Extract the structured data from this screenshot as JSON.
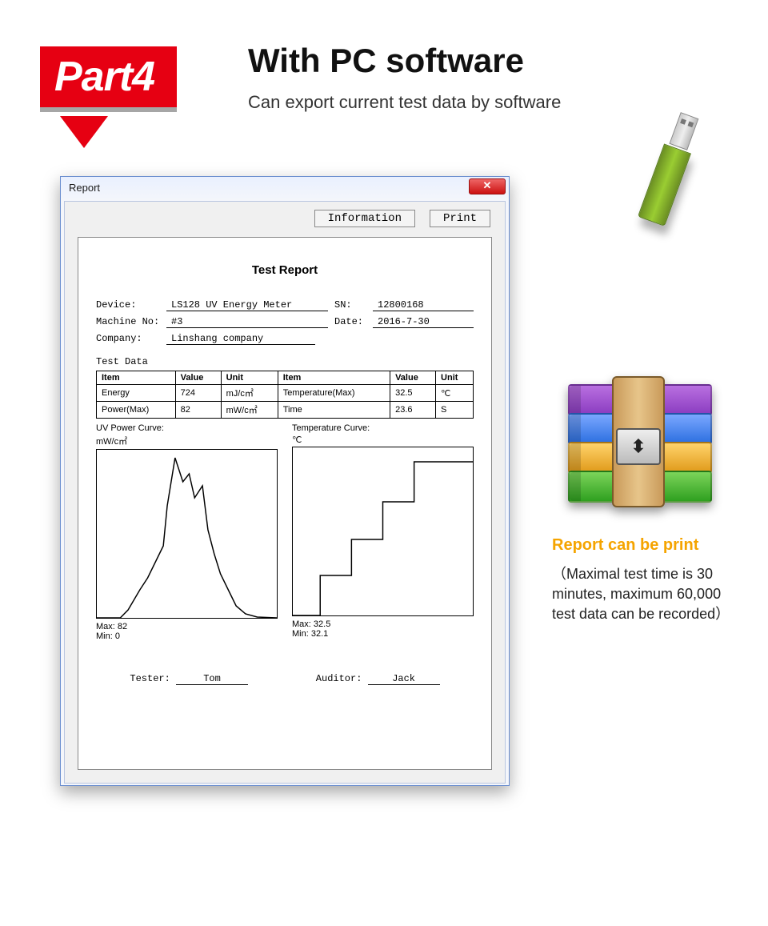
{
  "badge": "Part4",
  "headline": "With PC software",
  "subhead": "Can export current test data by software",
  "window": {
    "title": "Report",
    "toolbar": {
      "info": "Information",
      "print": "Print"
    },
    "report_title": "Test Report",
    "meta": {
      "device_label": "Device:",
      "device": "LS128 UV Energy Meter",
      "sn_label": "SN:",
      "sn": "12800168",
      "machine_label": "Machine No:",
      "machine": "#3",
      "date_label": "Date:",
      "date": "2016-7-30",
      "company_label": "Company:",
      "company": "Linshang company"
    },
    "section_test_data": "Test Data",
    "table": {
      "headers": [
        "Item",
        "Value",
        "Unit",
        "Item",
        "Value",
        "Unit"
      ],
      "rows": [
        [
          "Energy",
          "724",
          "mJ/c㎡",
          "Temperature(Max)",
          "32.5",
          "℃"
        ],
        [
          "Power(Max)",
          "82",
          "mW/c㎡",
          "Time",
          "23.6",
          "S"
        ]
      ]
    },
    "chart_left": {
      "title": "UV Power Curve:",
      "unit": "mW/c㎡",
      "max_label": "Max:",
      "max": "82",
      "min_label": "Min:",
      "min": "0"
    },
    "chart_right": {
      "title": "Temperature Curve:",
      "unit": "℃",
      "max_label": "Max:",
      "max": "32.5",
      "min_label": "Min:",
      "min": "32.1"
    },
    "tester_label": "Tester:",
    "tester": "Tom",
    "auditor_label": "Auditor:",
    "auditor": "Jack"
  },
  "print_head": "Report can be print",
  "print_body": "（Maximal test time is 30 minutes, maximum 60,000 test data can be recorded）",
  "chart_data": [
    {
      "type": "line",
      "title": "UV Power Curve",
      "ylabel": "mW/c㎡",
      "ylim": [
        0,
        82
      ],
      "x": [
        0,
        1,
        2,
        3,
        4,
        5,
        6,
        7,
        8,
        9,
        10,
        11,
        12,
        13,
        14,
        15,
        16,
        17,
        18,
        19,
        20,
        21,
        22,
        23
      ],
      "values": [
        0,
        0,
        0,
        0,
        10,
        25,
        35,
        48,
        60,
        72,
        82,
        80,
        70,
        55,
        60,
        42,
        30,
        18,
        10,
        4,
        1,
        0,
        0,
        0
      ],
      "stats": {
        "max": 82,
        "min": 0
      }
    },
    {
      "type": "line",
      "title": "Temperature Curve",
      "ylabel": "℃",
      "ylim": [
        32.1,
        32.5
      ],
      "x": [
        0,
        1,
        2,
        3,
        4,
        5,
        6,
        7,
        8,
        9,
        10,
        11,
        12,
        13,
        14,
        15,
        16,
        17,
        18,
        19,
        20,
        21,
        22,
        23
      ],
      "values": [
        32.1,
        32.1,
        32.1,
        32.1,
        32.1,
        32.2,
        32.2,
        32.2,
        32.2,
        32.3,
        32.3,
        32.3,
        32.3,
        32.4,
        32.4,
        32.4,
        32.5,
        32.5,
        32.5,
        32.5,
        32.5,
        32.5,
        32.5,
        32.5
      ],
      "stats": {
        "max": 32.5,
        "min": 32.1
      }
    }
  ]
}
